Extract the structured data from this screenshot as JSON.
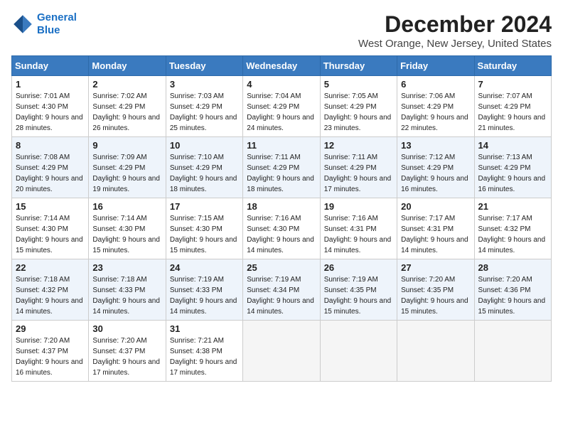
{
  "header": {
    "logo_line1": "General",
    "logo_line2": "Blue",
    "title": "December 2024",
    "subtitle": "West Orange, New Jersey, United States"
  },
  "days_of_week": [
    "Sunday",
    "Monday",
    "Tuesday",
    "Wednesday",
    "Thursday",
    "Friday",
    "Saturday"
  ],
  "weeks": [
    [
      {
        "num": "1",
        "rise": "7:01 AM",
        "set": "4:30 PM",
        "daylight": "9 hours and 28 minutes."
      },
      {
        "num": "2",
        "rise": "7:02 AM",
        "set": "4:29 PM",
        "daylight": "9 hours and 26 minutes."
      },
      {
        "num": "3",
        "rise": "7:03 AM",
        "set": "4:29 PM",
        "daylight": "9 hours and 25 minutes."
      },
      {
        "num": "4",
        "rise": "7:04 AM",
        "set": "4:29 PM",
        "daylight": "9 hours and 24 minutes."
      },
      {
        "num": "5",
        "rise": "7:05 AM",
        "set": "4:29 PM",
        "daylight": "9 hours and 23 minutes."
      },
      {
        "num": "6",
        "rise": "7:06 AM",
        "set": "4:29 PM",
        "daylight": "9 hours and 22 minutes."
      },
      {
        "num": "7",
        "rise": "7:07 AM",
        "set": "4:29 PM",
        "daylight": "9 hours and 21 minutes."
      }
    ],
    [
      {
        "num": "8",
        "rise": "7:08 AM",
        "set": "4:29 PM",
        "daylight": "9 hours and 20 minutes."
      },
      {
        "num": "9",
        "rise": "7:09 AM",
        "set": "4:29 PM",
        "daylight": "9 hours and 19 minutes."
      },
      {
        "num": "10",
        "rise": "7:10 AM",
        "set": "4:29 PM",
        "daylight": "9 hours and 18 minutes."
      },
      {
        "num": "11",
        "rise": "7:11 AM",
        "set": "4:29 PM",
        "daylight": "9 hours and 18 minutes."
      },
      {
        "num": "12",
        "rise": "7:11 AM",
        "set": "4:29 PM",
        "daylight": "9 hours and 17 minutes."
      },
      {
        "num": "13",
        "rise": "7:12 AM",
        "set": "4:29 PM",
        "daylight": "9 hours and 16 minutes."
      },
      {
        "num": "14",
        "rise": "7:13 AM",
        "set": "4:29 PM",
        "daylight": "9 hours and 16 minutes."
      }
    ],
    [
      {
        "num": "15",
        "rise": "7:14 AM",
        "set": "4:30 PM",
        "daylight": "9 hours and 15 minutes."
      },
      {
        "num": "16",
        "rise": "7:14 AM",
        "set": "4:30 PM",
        "daylight": "9 hours and 15 minutes."
      },
      {
        "num": "17",
        "rise": "7:15 AM",
        "set": "4:30 PM",
        "daylight": "9 hours and 15 minutes."
      },
      {
        "num": "18",
        "rise": "7:16 AM",
        "set": "4:30 PM",
        "daylight": "9 hours and 14 minutes."
      },
      {
        "num": "19",
        "rise": "7:16 AM",
        "set": "4:31 PM",
        "daylight": "9 hours and 14 minutes."
      },
      {
        "num": "20",
        "rise": "7:17 AM",
        "set": "4:31 PM",
        "daylight": "9 hours and 14 minutes."
      },
      {
        "num": "21",
        "rise": "7:17 AM",
        "set": "4:32 PM",
        "daylight": "9 hours and 14 minutes."
      }
    ],
    [
      {
        "num": "22",
        "rise": "7:18 AM",
        "set": "4:32 PM",
        "daylight": "9 hours and 14 minutes."
      },
      {
        "num": "23",
        "rise": "7:18 AM",
        "set": "4:33 PM",
        "daylight": "9 hours and 14 minutes."
      },
      {
        "num": "24",
        "rise": "7:19 AM",
        "set": "4:33 PM",
        "daylight": "9 hours and 14 minutes."
      },
      {
        "num": "25",
        "rise": "7:19 AM",
        "set": "4:34 PM",
        "daylight": "9 hours and 14 minutes."
      },
      {
        "num": "26",
        "rise": "7:19 AM",
        "set": "4:35 PM",
        "daylight": "9 hours and 15 minutes."
      },
      {
        "num": "27",
        "rise": "7:20 AM",
        "set": "4:35 PM",
        "daylight": "9 hours and 15 minutes."
      },
      {
        "num": "28",
        "rise": "7:20 AM",
        "set": "4:36 PM",
        "daylight": "9 hours and 15 minutes."
      }
    ],
    [
      {
        "num": "29",
        "rise": "7:20 AM",
        "set": "4:37 PM",
        "daylight": "9 hours and 16 minutes."
      },
      {
        "num": "30",
        "rise": "7:20 AM",
        "set": "4:37 PM",
        "daylight": "9 hours and 17 minutes."
      },
      {
        "num": "31",
        "rise": "7:21 AM",
        "set": "4:38 PM",
        "daylight": "9 hours and 17 minutes."
      },
      null,
      null,
      null,
      null
    ]
  ]
}
